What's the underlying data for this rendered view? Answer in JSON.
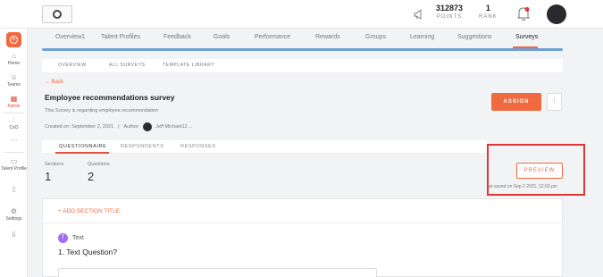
{
  "header": {
    "points_value": "312873",
    "points_label": "POINTS",
    "rank_value": "1",
    "rank_label": "RANK"
  },
  "sidebar": {
    "items": [
      {
        "label": "Home",
        "icon": "home-icon"
      },
      {
        "label": "Teams",
        "icon": "teams-icon"
      },
      {
        "label": "Admin",
        "icon": "admin-icon",
        "active": true
      },
      {
        "label": "CxO",
        "icon": "chart-icon"
      },
      {
        "label": "",
        "icon": "more-icon"
      },
      {
        "label": "Talent Profile",
        "icon": "profile-card-icon"
      },
      {
        "label": "",
        "icon": "apps-grid-icon"
      },
      {
        "label": "Settings",
        "icon": "gear-icon"
      },
      {
        "label": "",
        "icon": "upload-icon"
      }
    ]
  },
  "nav": {
    "tabs": [
      "Overview1",
      "Talent Profiles",
      "Feedback",
      "Goals",
      "Performance",
      "Rewards",
      "Groups",
      "Learning",
      "Suggestions",
      "Surveys"
    ],
    "active": "Surveys"
  },
  "subnav": {
    "items": [
      "OVERVIEW",
      "ALL SURVEYS",
      "TEMPLATE LIBRARY"
    ]
  },
  "survey": {
    "back_label": "← Back",
    "title": "Employee recommendations survey",
    "description": "This Survey is regarding employee recommendation",
    "created_on": "Created on: September 2, 2021",
    "separator": "|",
    "author_label": "Author:",
    "author_name": "Jeff Michael12 ...",
    "assign_label": "ASSIGN",
    "kebab_label": "⋮"
  },
  "inner_tabs": {
    "items": [
      "QUESTIONNAIRE",
      "RESPONDENTS",
      "RESPONSES"
    ],
    "active": "QUESTIONNAIRE"
  },
  "stats": {
    "sections_label": "Sections",
    "sections_value": "1",
    "questions_label": "Questions",
    "questions_value": "2"
  },
  "preview": {
    "button_label": "PREVIEW",
    "saved_text": "ast saved on Sep 2 2021, 12:03 pm"
  },
  "editor": {
    "add_section_label": "+ ADD SECTION TITLE",
    "question_type_badge": "T",
    "question_type": "Text",
    "question_text": "1. Text Question?"
  },
  "colors": {
    "accent": "#f06a3f",
    "highlight_box": "#e03636",
    "nav_underline": "#6f9fd6",
    "question_badge": "#a06cf0"
  }
}
